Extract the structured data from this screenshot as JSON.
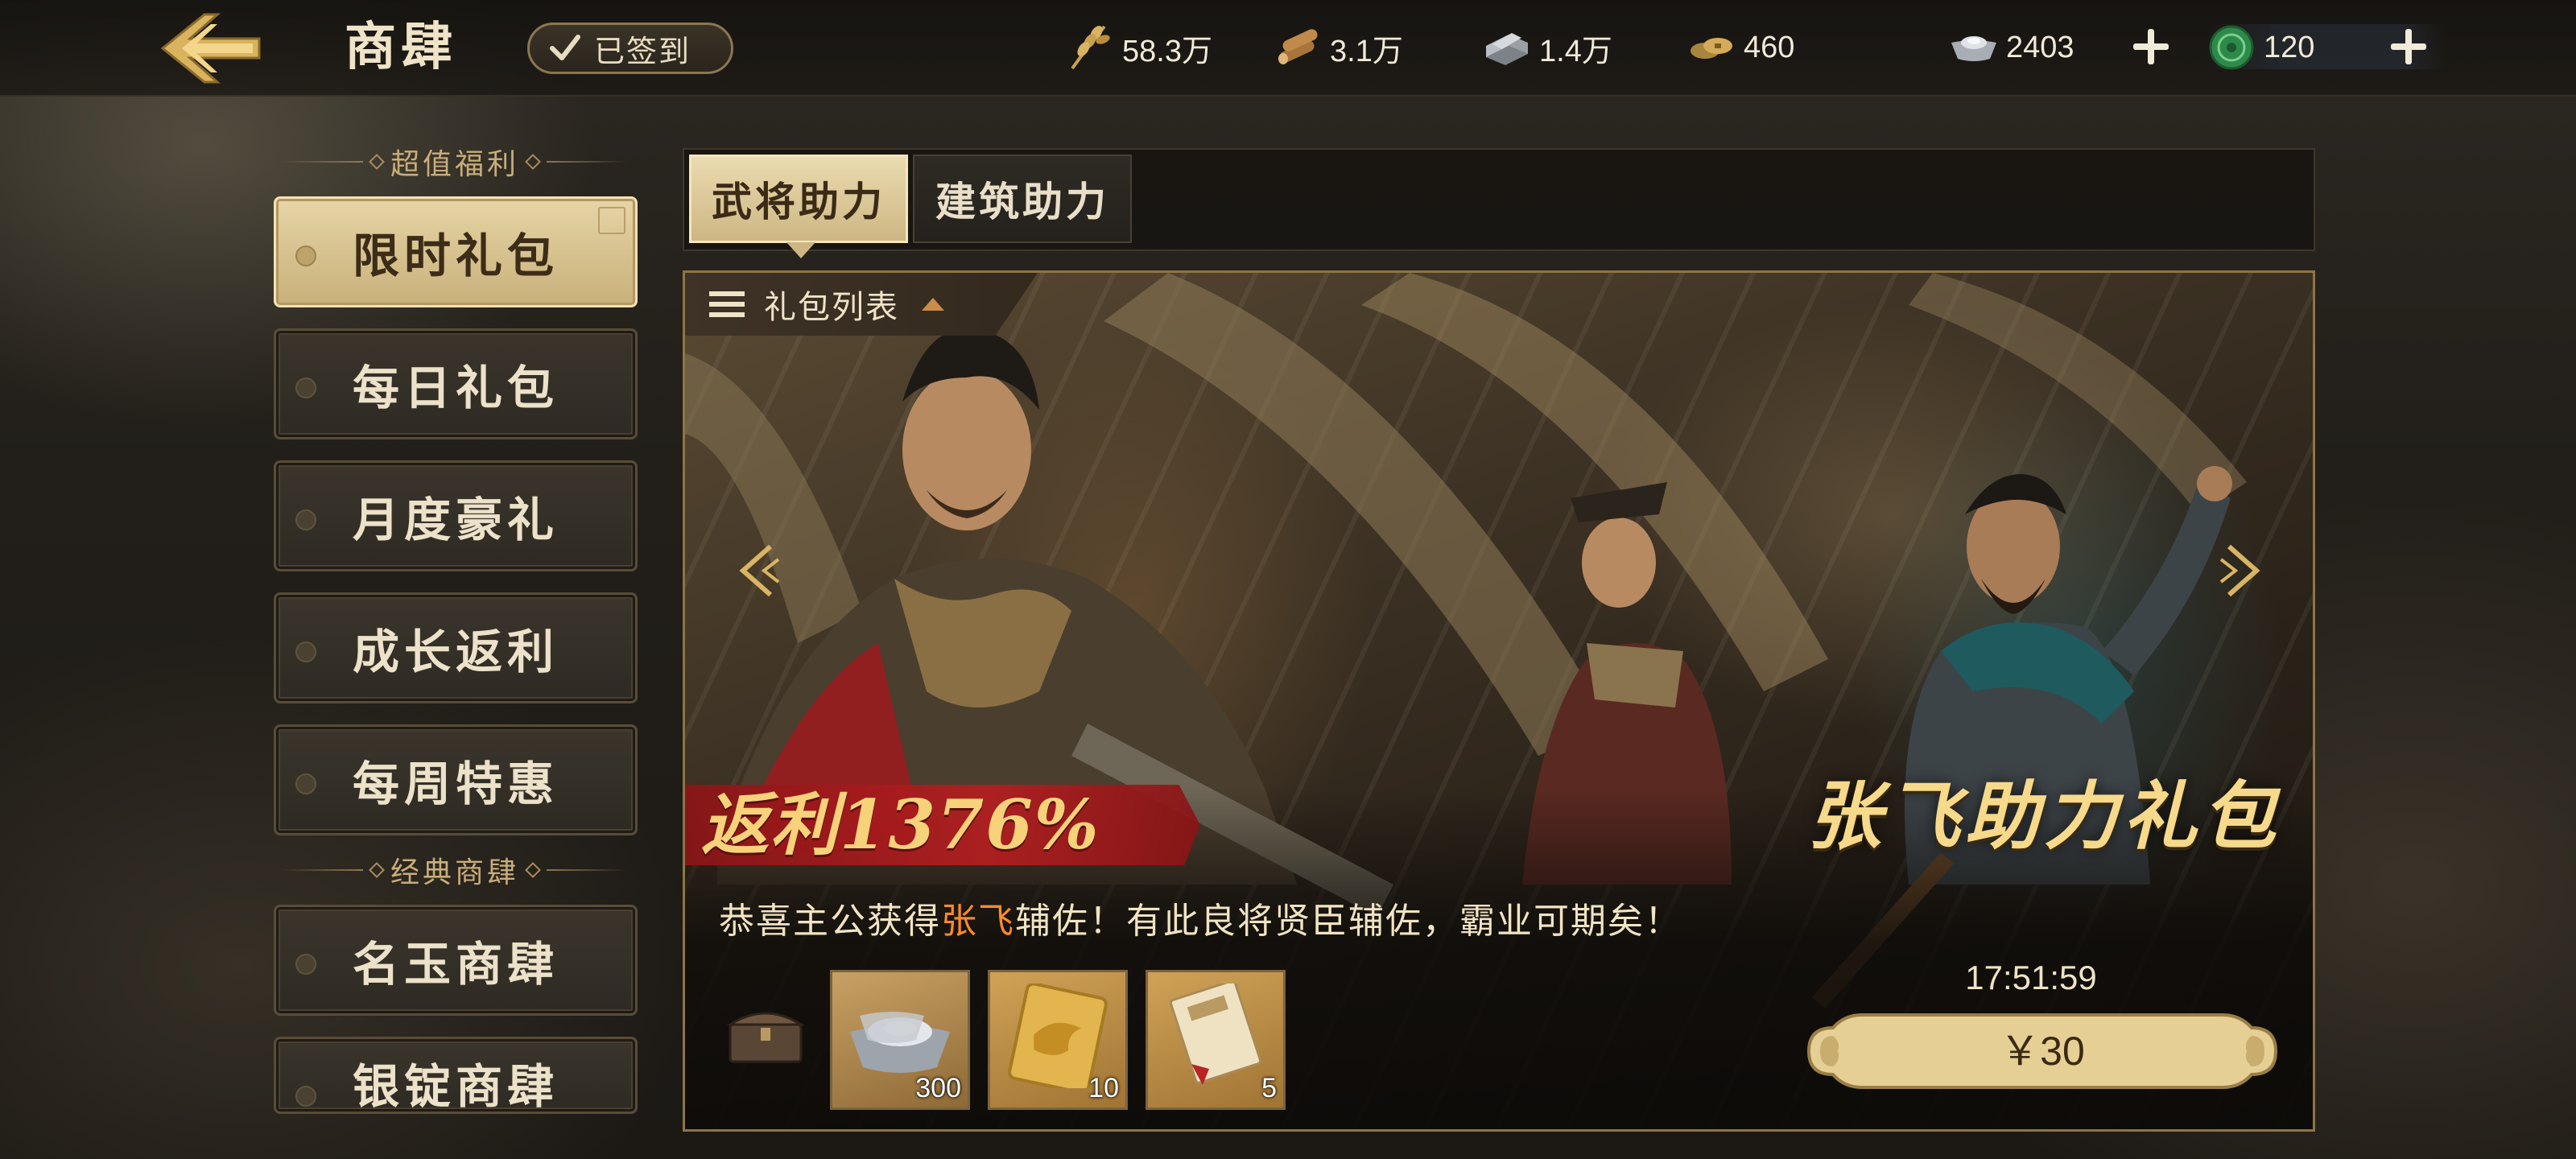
{
  "header": {
    "title": "商肆",
    "signin_label": "已签到",
    "resources": [
      {
        "name": "grain-icon",
        "value": "58.3万"
      },
      {
        "name": "wood-icon",
        "value": "3.1万"
      },
      {
        "name": "iron-icon",
        "value": "1.4万"
      },
      {
        "name": "copper-coin-icon",
        "value": "460"
      }
    ],
    "silver": "2403",
    "jade": "120"
  },
  "sidebar": {
    "section1": "超值福利",
    "section2": "经典商肆",
    "items": [
      {
        "label": "限时礼包",
        "active": true
      },
      {
        "label": "每日礼包"
      },
      {
        "label": "月度豪礼"
      },
      {
        "label": "成长返利"
      },
      {
        "label": "每周特惠"
      },
      {
        "label": "名玉商肆"
      },
      {
        "label": "银锭商肆"
      }
    ]
  },
  "tabs": [
    {
      "label": "武将助力",
      "active": true
    },
    {
      "label": "建筑助力"
    }
  ],
  "banner": {
    "list_label": "礼包列表",
    "rebate": "返利1376%",
    "title": "张飞助力礼包",
    "desc_prefix": "恭喜主公获得",
    "desc_highlight": "张飞",
    "desc_suffix": "辅佐！有此良将贤臣辅佐，霸业可期矣！",
    "rewards": [
      {
        "icon": "silver-ingot-icon",
        "qty": "300"
      },
      {
        "icon": "gold-token-icon",
        "qty": "10"
      },
      {
        "icon": "scroll-book-icon",
        "qty": "5"
      }
    ],
    "countdown": "17:51:59",
    "price": "￥30"
  },
  "colors": {
    "gold": "#f6d98a",
    "highlight": "#ff8a2a",
    "ribbon_red": "#b51e20",
    "active_tab": "#eadbb0"
  }
}
